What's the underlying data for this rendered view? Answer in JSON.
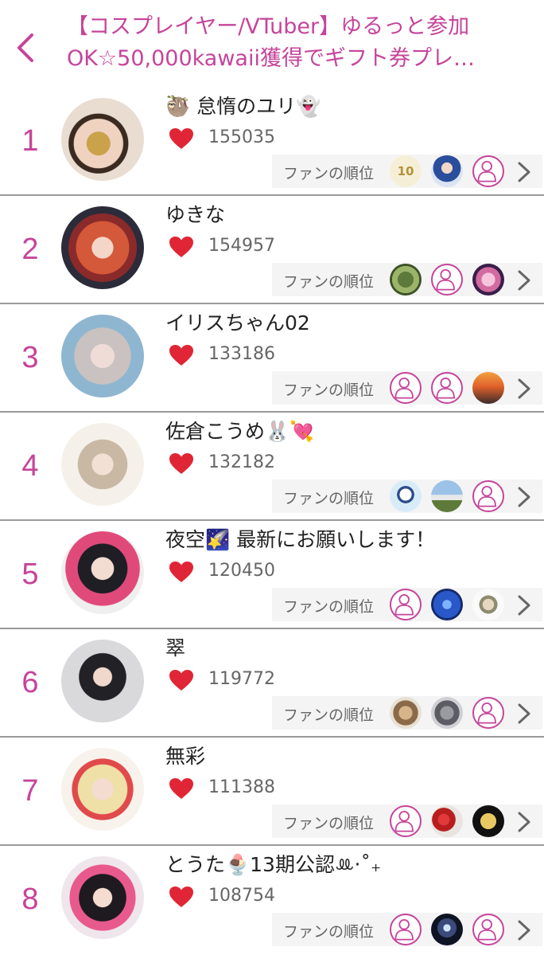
{
  "header": {
    "title_line1": "【コスプレイヤー/VTuber】ゆるっと参加",
    "title_line2": "OK☆50,000kawaii獲得でギフト券プレ…"
  },
  "colors": {
    "accent": "#c6449a",
    "heart": "#e02636",
    "divider": "#9a9a9a",
    "fanbar_bg": "#f4f4f4"
  },
  "fan_label": "ファンの順位",
  "rows": [
    {
      "rank": "1",
      "name": "🦥 怠惰のユリ👻",
      "score": "155035",
      "fans": [
        "10th-logo",
        "anime-avatar",
        "placeholder"
      ]
    },
    {
      "rank": "2",
      "name": "ゆきな",
      "score": "154957",
      "fans": [
        "nature-photo",
        "placeholder",
        "pink-orb-photo"
      ]
    },
    {
      "rank": "3",
      "name": "イリスちゃん02",
      "score": "133186",
      "fans": [
        "placeholder",
        "placeholder",
        "sunset-photo"
      ]
    },
    {
      "rank": "4",
      "name": "佐倉こうめ🐰💘",
      "score": "132182",
      "fans": [
        "baseball-cartoon",
        "car-photo",
        "placeholder"
      ]
    },
    {
      "rank": "5",
      "name": "夜空🌠 最新にお願いします！",
      "score": "120450",
      "fans": [
        "placeholder",
        "blue-emblem",
        "anime-character"
      ]
    },
    {
      "rank": "6",
      "name": "翠",
      "score": "119772",
      "fans": [
        "cat-photo",
        "rabbit-photo",
        "placeholder"
      ]
    },
    {
      "rank": "7",
      "name": "無彩",
      "score": "111388",
      "fans": [
        "placeholder",
        "red-fruit-photo",
        "moon-photo"
      ]
    },
    {
      "rank": "8",
      "name": "とうた🍨13期公認ꔛ‧˚₊",
      "score": "108754",
      "fans": [
        "placeholder",
        "night-photo",
        "placeholder"
      ]
    }
  ]
}
